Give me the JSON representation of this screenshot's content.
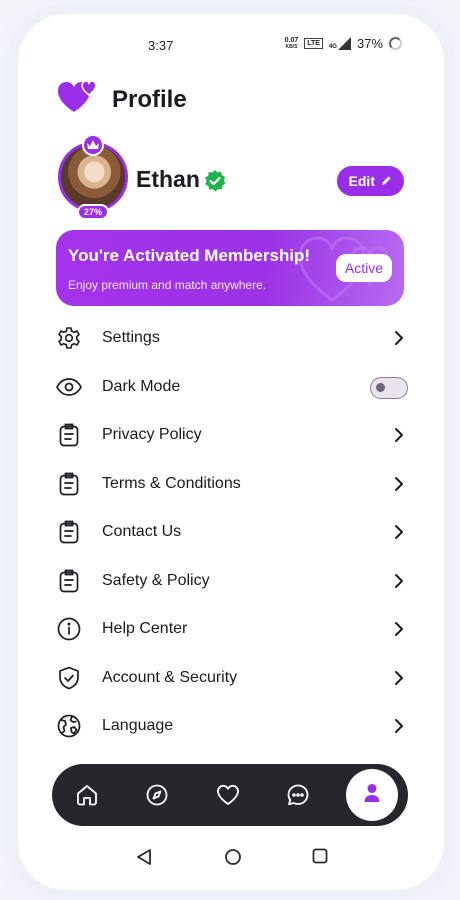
{
  "status_bar": {
    "time": "3:37",
    "net_speed_value": "0.07",
    "net_speed_unit": "KB/S",
    "network_badge": "LTE",
    "signal_label": "4G",
    "battery": "37%"
  },
  "header": {
    "title": "Profile",
    "logo_icon": "hearts-logo-icon"
  },
  "profile": {
    "name": "Ethan",
    "completion": "27%",
    "edit_label": "Edit",
    "verified_icon": "verified-check-icon"
  },
  "membership": {
    "title": "You're Activated Membership!",
    "subtitle": "Enjoy  premium and match anywhere.",
    "status": "Active"
  },
  "menu": {
    "items": [
      {
        "label": "Settings",
        "icon": "gear-icon"
      },
      {
        "label": "Dark Mode",
        "icon": "eye-icon",
        "toggle": false
      },
      {
        "label": "Privacy Policy",
        "icon": "clipboard-icon"
      },
      {
        "label": "Terms & Conditions",
        "icon": "clipboard-icon"
      },
      {
        "label": "Contact Us",
        "icon": "clipboard-icon"
      },
      {
        "label": "Safety & Policy",
        "icon": "clipboard-icon"
      },
      {
        "label": "Help Center",
        "icon": "info-icon"
      },
      {
        "label": "Account & Security",
        "icon": "shield-icon"
      },
      {
        "label": "Language",
        "icon": "globe-icon"
      }
    ]
  },
  "bottom_nav": {
    "items": [
      "home-icon",
      "compass-icon",
      "heart-icon",
      "chat-icon",
      "profile-icon"
    ],
    "active": "profile-icon"
  },
  "colors": {
    "accent": "#9a2ee8",
    "nav_bg": "#26262c",
    "text": "#1b1b22"
  }
}
